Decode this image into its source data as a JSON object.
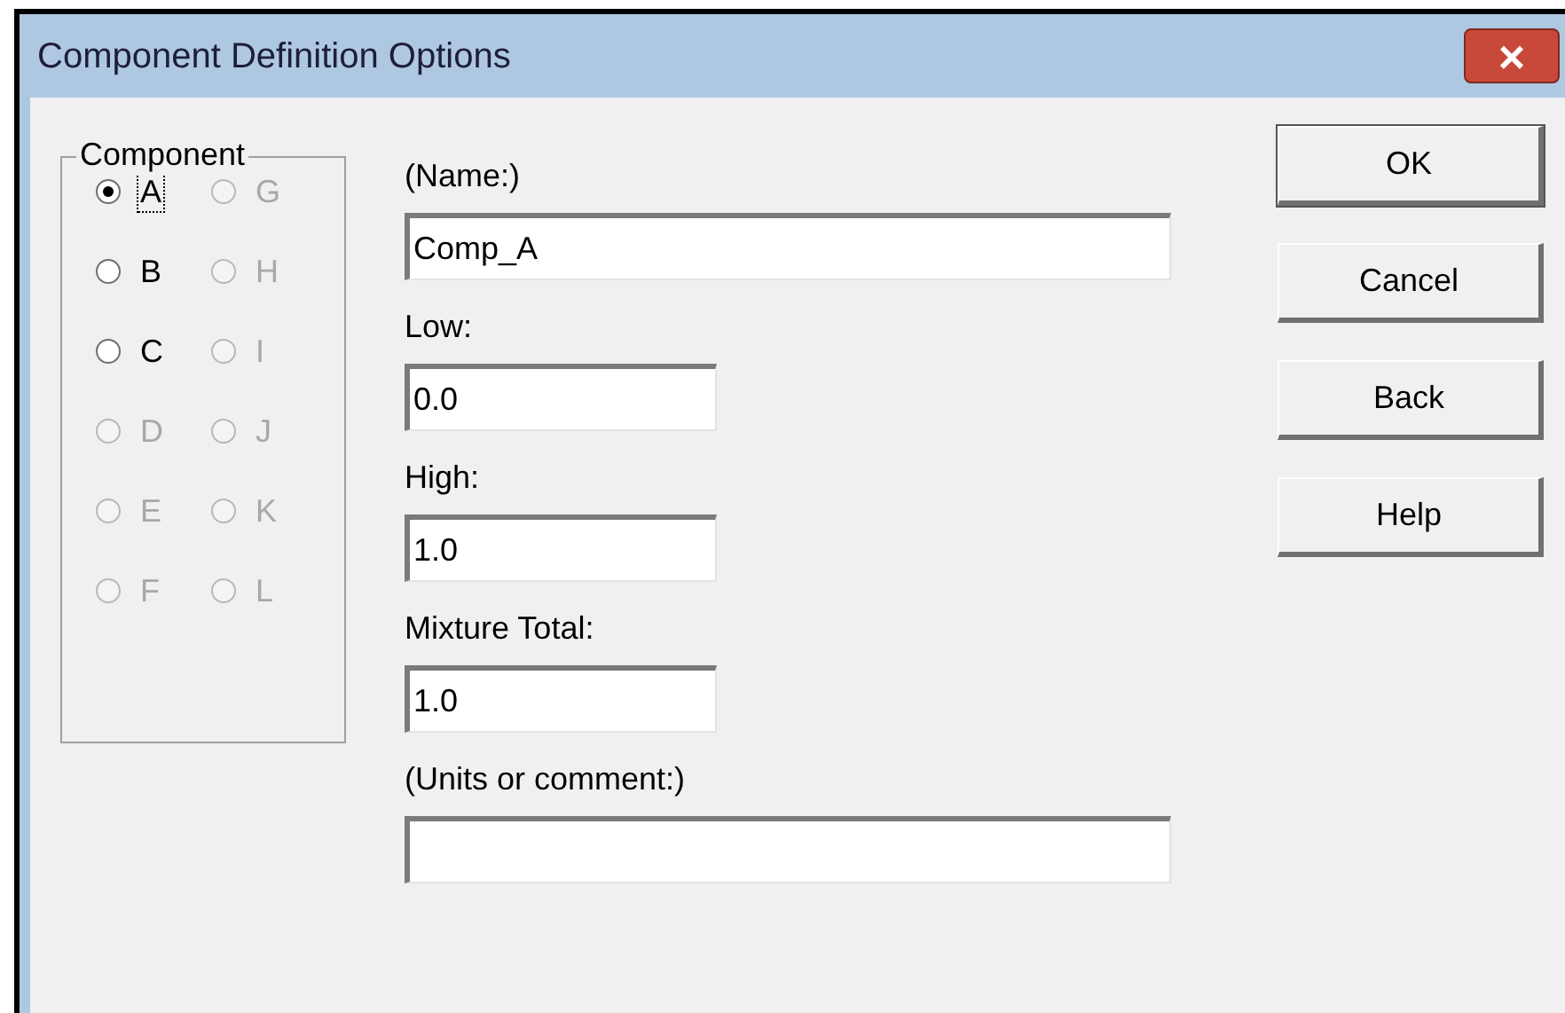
{
  "window": {
    "title": "Component Definition Options",
    "close": "×"
  },
  "component_group": {
    "title": "Component",
    "options": [
      {
        "label": "A",
        "selected": true,
        "disabled": false,
        "focused": true
      },
      {
        "label": "B",
        "selected": false,
        "disabled": false,
        "focused": false
      },
      {
        "label": "C",
        "selected": false,
        "disabled": false,
        "focused": false
      },
      {
        "label": "D",
        "selected": false,
        "disabled": true,
        "focused": false
      },
      {
        "label": "E",
        "selected": false,
        "disabled": true,
        "focused": false
      },
      {
        "label": "F",
        "selected": false,
        "disabled": true,
        "focused": false
      },
      {
        "label": "G",
        "selected": false,
        "disabled": true,
        "focused": false
      },
      {
        "label": "H",
        "selected": false,
        "disabled": true,
        "focused": false
      },
      {
        "label": "I",
        "selected": false,
        "disabled": true,
        "focused": false
      },
      {
        "label": "J",
        "selected": false,
        "disabled": true,
        "focused": false
      },
      {
        "label": "K",
        "selected": false,
        "disabled": true,
        "focused": false
      },
      {
        "label": "L",
        "selected": false,
        "disabled": true,
        "focused": false
      }
    ]
  },
  "fields": [
    {
      "label": "(Name:)",
      "value": "Comp_A",
      "kind": "wide"
    },
    {
      "label": "Low:",
      "value": "0.0",
      "kind": "narrow"
    },
    {
      "label": "High:",
      "value": "1.0",
      "kind": "narrow"
    },
    {
      "label": "Mixture Total:",
      "value": "1.0",
      "kind": "narrow"
    },
    {
      "label": "(Units or comment:)",
      "kind": "wide"
    }
  ],
  "buttons": [
    "OK",
    "Cancel",
    "Back",
    "Help"
  ]
}
